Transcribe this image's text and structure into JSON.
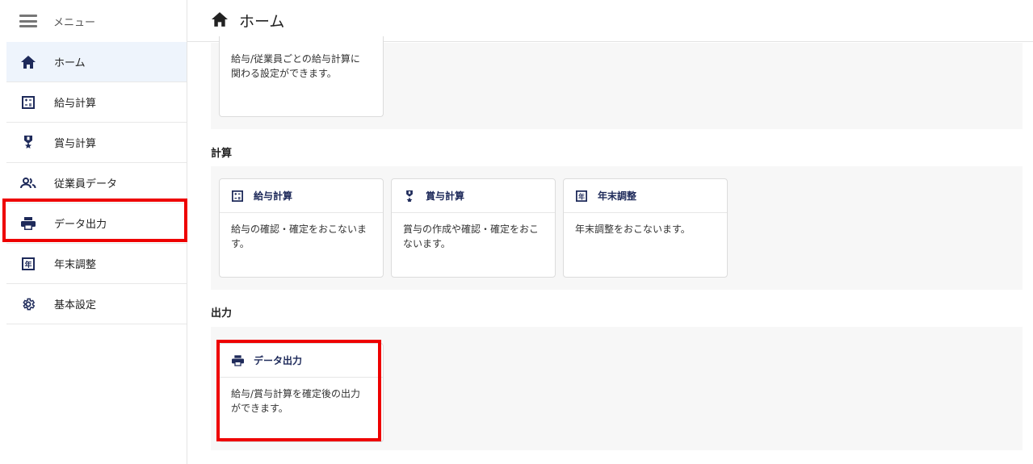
{
  "sidebar": {
    "menu_label": "メニュー",
    "items": [
      {
        "label": "ホーム",
        "icon": "home-icon"
      },
      {
        "label": "給与計算",
        "icon": "calculator-icon"
      },
      {
        "label": "賞与計算",
        "icon": "medal-icon"
      },
      {
        "label": "従業員データ",
        "icon": "people-icon"
      },
      {
        "label": "データ出力",
        "icon": "printer-icon"
      },
      {
        "label": "年末調整",
        "icon": "year-icon"
      },
      {
        "label": "基本設定",
        "icon": "gear-icon"
      }
    ]
  },
  "header": {
    "title": "ホーム",
    "icon": "home-icon"
  },
  "main": {
    "top_card": {
      "desc_line1": "給与/従業員ごとの給与計算に",
      "desc_line2": "関わる設定ができます。"
    },
    "section_calc": {
      "title": "計算",
      "cards": [
        {
          "title": "給与計算",
          "desc_line1": "給与の確認・確定をおこないま",
          "desc_line2": "す。"
        },
        {
          "title": "賞与計算",
          "desc_line1": "賞与の作成や確認・確定をおこ",
          "desc_line2": "ないます。"
        },
        {
          "title": "年末調整",
          "desc_line1": "年末調整をおこないます。",
          "desc_line2": ""
        }
      ]
    },
    "section_output": {
      "title": "出力",
      "cards": [
        {
          "title": "データ出力",
          "desc_line1": "給与/賞与計算を確定後の出力",
          "desc_line2": "ができます。"
        }
      ]
    }
  },
  "colors": {
    "accent_dark": "#1e2a5a",
    "highlight": "#ee0000",
    "active_bg": "#eef4fc"
  }
}
